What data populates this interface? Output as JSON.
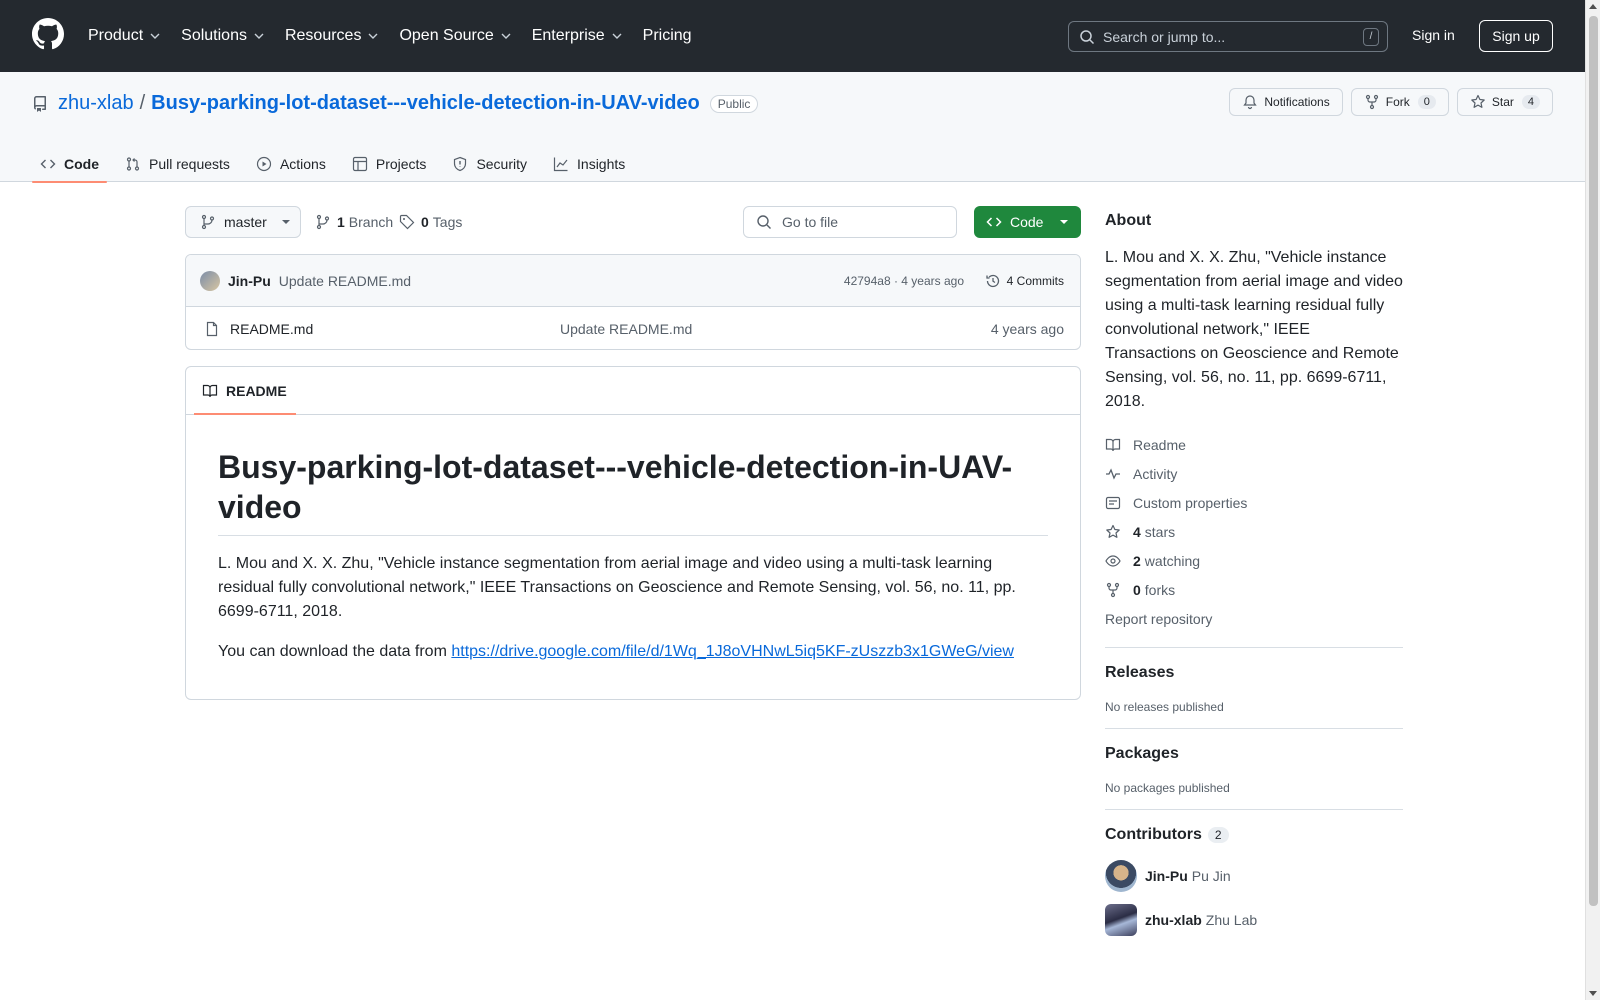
{
  "header": {
    "nav": [
      "Product",
      "Solutions",
      "Resources",
      "Open Source",
      "Enterprise",
      "Pricing"
    ],
    "search_placeholder": "Search or jump to...",
    "search_shortcut": "/",
    "sign_in": "Sign in",
    "sign_up": "Sign up"
  },
  "repo": {
    "owner": "zhu-xlab",
    "separator": "/",
    "name": "Busy-parking-lot-dataset---vehicle-detection-in-UAV-video",
    "visibility": "Public",
    "notifications": "Notifications",
    "fork_label": "Fork",
    "fork_count": "0",
    "star_label": "Star",
    "star_count": "4"
  },
  "tabs": [
    "Code",
    "Pull requests",
    "Actions",
    "Projects",
    "Security",
    "Insights"
  ],
  "toolbar": {
    "branch": "master",
    "branches_count": "1",
    "branches_label": "Branch",
    "tags_count": "0",
    "tags_label": "Tags",
    "goto_placeholder": "Go to file",
    "code_button": "Code"
  },
  "commit": {
    "author": "Jin-Pu",
    "message": "Update README.md",
    "meta": "42794a8 · 4 years ago",
    "commits": "4 Commits"
  },
  "files": [
    {
      "name": "README.md",
      "message": "Update README.md",
      "date": "4 years ago"
    }
  ],
  "readme": {
    "tab": "README",
    "title": "Busy-parking-lot-dataset---vehicle-detection-in-UAV-video",
    "paragraph": "L. Mou and X. X. Zhu, \"Vehicle instance segmentation from aerial image and video using a multi-task learning residual fully convolutional network,\" IEEE Transactions on Geoscience and Remote Sensing, vol. 56, no. 11, pp. 6699-6711, 2018.",
    "download_prefix": "You can download the data from ",
    "download_link": "https://drive.google.com/file/d/1Wq_1J8oVHNwL5iq5KF-zUszzb3x1GWeG/view"
  },
  "about": {
    "heading": "About",
    "description": "L. Mou and X. X. Zhu, \"Vehicle instance segmentation from aerial image and video using a multi-task learning residual fully convolutional network,\" IEEE Transactions on Geoscience and Remote Sensing, vol. 56, no. 11, pp. 6699-6711, 2018.",
    "readme": "Readme",
    "activity": "Activity",
    "custom_properties": "Custom properties",
    "stars_count": "4",
    "stars_label": "stars",
    "watching_count": "2",
    "watching_label": "watching",
    "forks_count": "0",
    "forks_label": "forks",
    "report": "Report repository"
  },
  "releases": {
    "heading": "Releases",
    "text": "No releases published"
  },
  "packages": {
    "heading": "Packages",
    "text": "No packages published"
  },
  "contributors": {
    "heading": "Contributors",
    "count": "2",
    "list": [
      {
        "login": "Jin-Pu",
        "name": "Pu Jin"
      },
      {
        "login": "zhu-xlab",
        "name": "Zhu Lab"
      }
    ]
  },
  "colors": {
    "header_bg": "#24292f",
    "link": "#0969da",
    "primary_button": "#1f883d",
    "tab_underline": "#fd8c73"
  }
}
